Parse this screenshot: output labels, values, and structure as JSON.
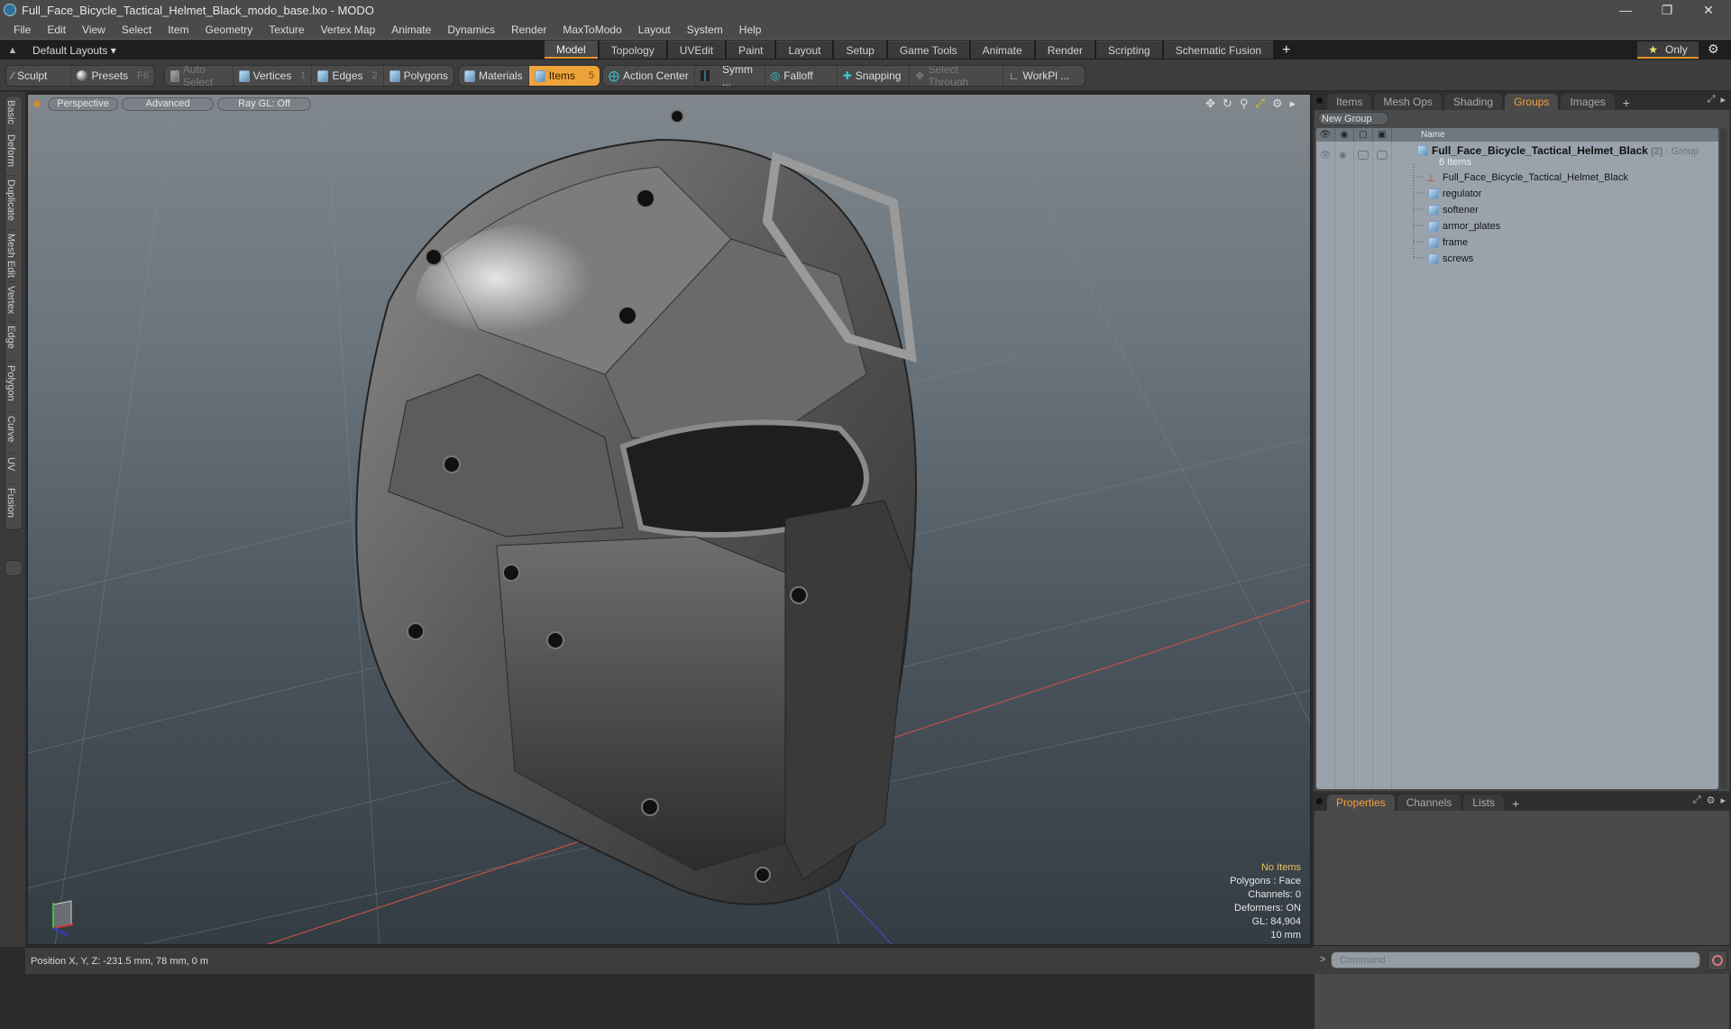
{
  "window": {
    "title": "Full_Face_Bicycle_Tactical_Helmet_Black_modo_base.lxo - MODO",
    "controls": [
      "minimize",
      "restore",
      "close"
    ]
  },
  "menubar": {
    "items": [
      "File",
      "Edit",
      "View",
      "Select",
      "Item",
      "Geometry",
      "Texture",
      "Vertex Map",
      "Animate",
      "Dynamics",
      "Render",
      "MaxToModo",
      "Layout",
      "System",
      "Help"
    ]
  },
  "layoutbar": {
    "layouts_label": "Default Layouts ▾",
    "tabs": [
      {
        "label": "Model",
        "active": true
      },
      {
        "label": "Topology"
      },
      {
        "label": "UVEdit"
      },
      {
        "label": "Paint"
      },
      {
        "label": "Layout"
      },
      {
        "label": "Setup"
      },
      {
        "label": "Game Tools"
      },
      {
        "label": "Animate"
      },
      {
        "label": "Render"
      },
      {
        "label": "Scripting"
      },
      {
        "label": "Schematic Fusion"
      }
    ],
    "add_tab": "+",
    "only_label": "Only"
  },
  "toolbar": {
    "sculpt": "Sculpt",
    "presets": "Presets",
    "presets_key": "F6",
    "auto_select": "Auto Select",
    "vertices": "Vertices",
    "vertices_key": "1",
    "edges": "Edges",
    "edges_key": "2",
    "polygons": "Polygons",
    "materials": "Materials",
    "items": "Items",
    "items_key": "5",
    "action_center": "Action Center",
    "symmetry": "Symm ...",
    "falloff": "Falloff",
    "snapping": "Snapping",
    "select_through": "Select Through",
    "workplane": "WorkPl ..."
  },
  "left_tabs": [
    "Basic",
    "Deform",
    "Duplicate",
    "Mesh Edit",
    "Vertex",
    "Edge",
    "Polygon",
    "Curve",
    "UV",
    "Fusion"
  ],
  "viewport": {
    "view_mode": "Perspective",
    "shading": "Advanced",
    "raygl": "Ray GL: Off",
    "info": {
      "selection": "No Items",
      "polygons": "Polygons : Face",
      "channels": "Channels: 0",
      "deformers": "Deformers: ON",
      "gl": "GL: 84,904",
      "grid": "10 mm"
    }
  },
  "statusbar": {
    "position": "Position X, Y, Z:   -231.5 mm, 78 mm, 0 m"
  },
  "right_panel": {
    "top_tabs": [
      {
        "label": "Items"
      },
      {
        "label": "Mesh Ops"
      },
      {
        "label": "Shading"
      },
      {
        "label": "Groups",
        "active": true
      },
      {
        "label": "Images"
      }
    ],
    "new_group": "New Group",
    "tree_header": {
      "name": "Name"
    },
    "group": {
      "name": "Full_Face_Bicycle_Tactical_Helmet_Black",
      "count": "(2)",
      "type": ": Group",
      "sub": "6 Items"
    },
    "items": [
      {
        "name": "Full_Face_Bicycle_Tactical_Helmet_Black",
        "icon": "locator-icon"
      },
      {
        "name": "regulator",
        "icon": "mesh-icon"
      },
      {
        "name": "softener",
        "icon": "mesh-icon"
      },
      {
        "name": "armor_plates",
        "icon": "mesh-icon"
      },
      {
        "name": "frame",
        "icon": "mesh-icon"
      },
      {
        "name": "screws",
        "icon": "mesh-icon"
      }
    ],
    "bottom_tabs": [
      {
        "label": "Properties",
        "active": true
      },
      {
        "label": "Channels"
      },
      {
        "label": "Lists"
      }
    ],
    "command_placeholder": "Command"
  },
  "colors": {
    "accent": "#e8952e",
    "active_tool": "#eea23a",
    "active_tab_text": "#f0a040"
  }
}
